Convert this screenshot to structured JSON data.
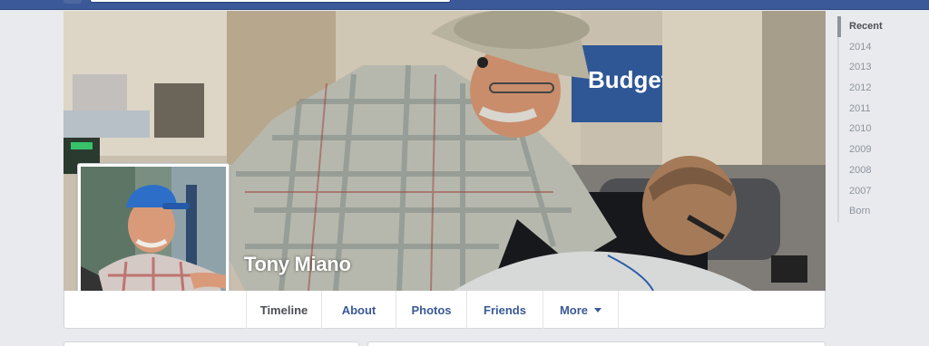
{
  "profile": {
    "name": "Tony Miano"
  },
  "nav": {
    "tabs": [
      {
        "label": "Timeline"
      },
      {
        "label": "About"
      },
      {
        "label": "Photos"
      },
      {
        "label": "Friends"
      },
      {
        "label": "More"
      }
    ]
  },
  "scrubber": {
    "items": [
      "Recent",
      "2014",
      "2013",
      "2012",
      "2011",
      "2010",
      "2009",
      "2008",
      "2007",
      "Born"
    ]
  },
  "cover_sign": {
    "text": "Budget"
  },
  "colors": {
    "brand": "#3b5998",
    "link": "#3b5998",
    "background": "#e9eaed"
  }
}
